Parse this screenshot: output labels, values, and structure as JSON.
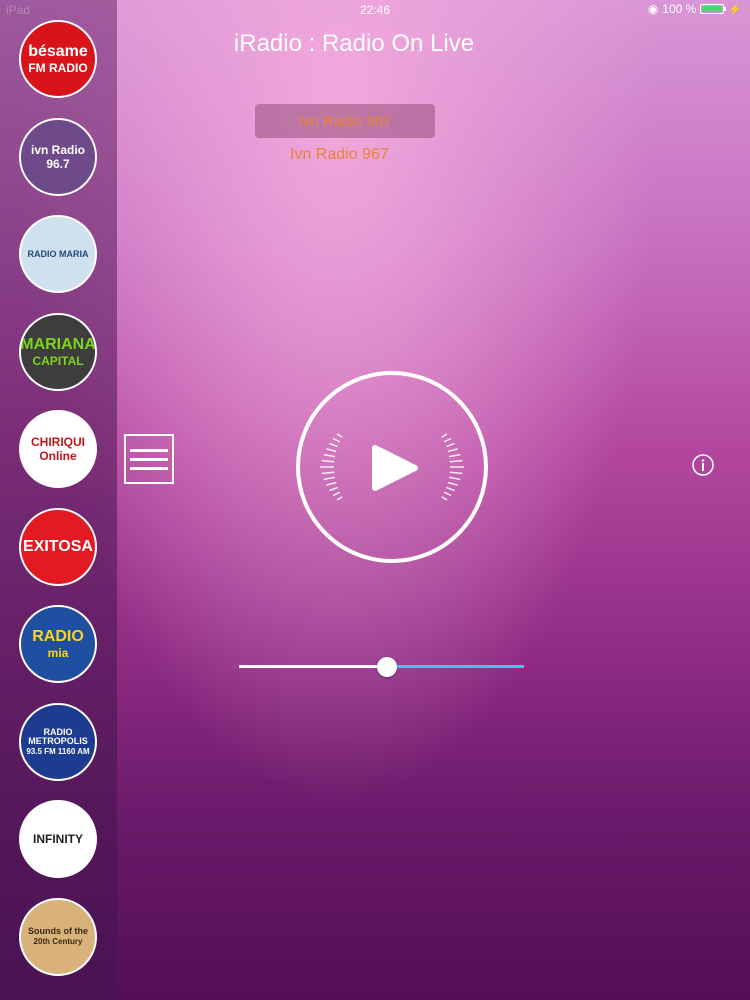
{
  "status_bar": {
    "device": "iPad",
    "time": "22:46",
    "battery": "100 %",
    "battery_level": 1.0
  },
  "app": {
    "title": "iRadio : Radio On Live"
  },
  "player": {
    "selected_station": "Ivn Radio 967",
    "now_playing": "Ivn Radio 967",
    "volume_level": 0.52
  },
  "colors": {
    "accent": "#e8833a",
    "volume_max_track": "#3ec8e8",
    "battery_fill": "#4cd964"
  },
  "stations": [
    {
      "line1": "bésame",
      "line2": "FM RADIO",
      "bg": "#d8141a",
      "fg": "#ffffff"
    },
    {
      "line1": "ivn Radio",
      "line2": "96.7",
      "bg": "#6e4a8a",
      "fg": "#ffffff"
    },
    {
      "line1": "RADIO MARIA",
      "line2": "",
      "bg": "#cfe0ee",
      "fg": "#244a7a"
    },
    {
      "line1": "MARIANA",
      "line2": "CAPITAL",
      "bg": "#3d3d3d",
      "fg": "#7ed321"
    },
    {
      "line1": "CHIRIQUI",
      "line2": "Online",
      "bg": "#ffffff",
      "fg": "#c0161d"
    },
    {
      "line1": "EXITOSA",
      "line2": "",
      "bg": "#e21b23",
      "fg": "#ffffff"
    },
    {
      "line1": "RADIO",
      "line2": "mia",
      "bg": "#1f4fa0",
      "fg": "#ffd21a"
    },
    {
      "line1": "RADIO METROPOLIS",
      "line2": "93.5 FM 1160 AM",
      "bg": "#1d3c8f",
      "fg": "#ffffff"
    },
    {
      "line1": "INFINITY",
      "line2": "",
      "bg": "#ffffff",
      "fg": "#222222"
    },
    {
      "line1": "Sounds of the",
      "line2": "20th Century",
      "bg": "#d8b27a",
      "fg": "#3a2a12"
    }
  ]
}
